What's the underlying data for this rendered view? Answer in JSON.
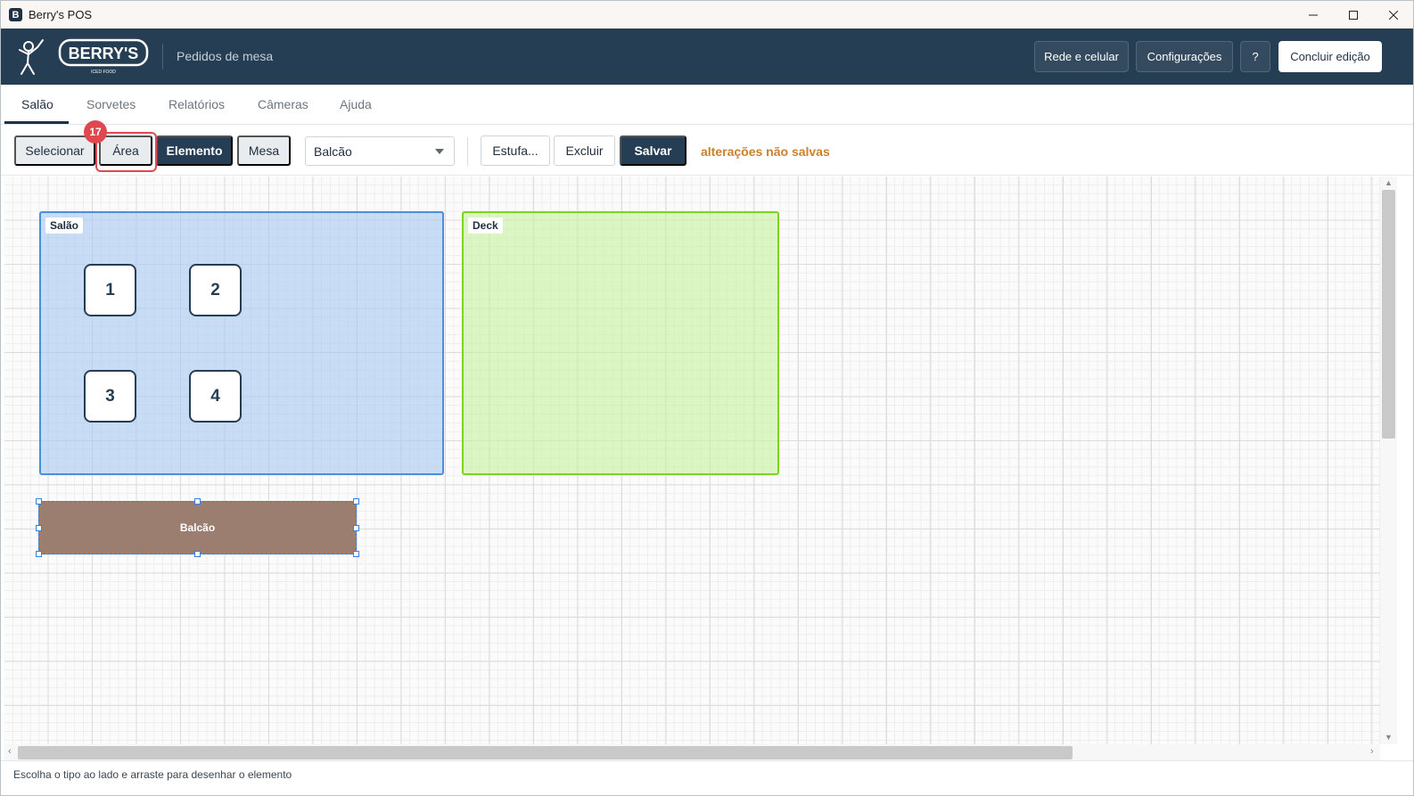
{
  "window": {
    "title": "Berry's POS"
  },
  "header": {
    "logo_text": "BERRY'S",
    "logo_subtext": "ICED FOOD",
    "subtitle": "Pedidos de mesa",
    "buttons": {
      "network": "Rede e celular",
      "settings": "Configurações",
      "help": "?",
      "finish": "Concluir edição"
    }
  },
  "tabs": [
    {
      "label": "Salão",
      "active": true
    },
    {
      "label": "Sorvetes",
      "active": false
    },
    {
      "label": "Relatórios",
      "active": false
    },
    {
      "label": "Câmeras",
      "active": false
    },
    {
      "label": "Ajuda",
      "active": false
    }
  ],
  "toolbar": {
    "select_label": "Selecionar",
    "area_label": "Área",
    "element_label": "Elemento",
    "table_label": "Mesa",
    "element_type_value": "Balcão",
    "estufa_label": "Estufa...",
    "delete_label": "Excluir",
    "save_label": "Salvar",
    "unsaved_text": "alterações não salvas",
    "badge": "17"
  },
  "floor": {
    "areas": [
      {
        "label": "Salão",
        "color": "#4a8fdc"
      },
      {
        "label": "Deck",
        "color": "#7ed321"
      }
    ],
    "tables": [
      "1",
      "2",
      "3",
      "4"
    ],
    "elements": [
      {
        "label": "Balcão",
        "color": "#9b7e70"
      }
    ]
  },
  "status": {
    "text": "Escolha o tipo ao lado e arraste para desenhar o elemento"
  },
  "colors": {
    "header_bg": "#263e54",
    "accent_dark": "#263e54",
    "highlight": "#e0484f",
    "unsaved": "#c9812c"
  }
}
